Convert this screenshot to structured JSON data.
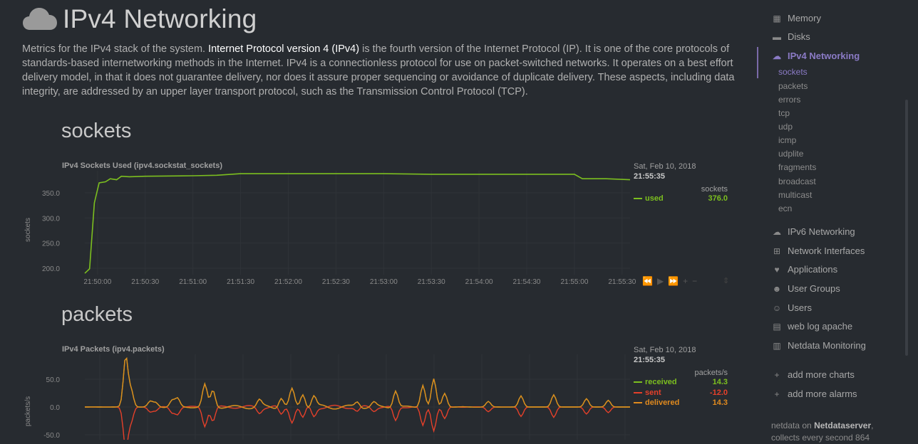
{
  "page": {
    "title": "IPv4 Networking",
    "intro_before": "Metrics for the IPv4 stack of the system. ",
    "intro_link": "Internet Protocol version 4 (IPv4)",
    "intro_after": " is the fourth version of the Internet Protocol (IP). It is one of the core protocols of standards-based internetworking methods in the Internet. IPv4 is a connectionless protocol for use on packet-switched networks. It operates on a best effort delivery model, in that it does not guarantee delivery, nor does it assure proper sequencing or avoidance of duplicate delivery. These aspects, including data integrity, are addressed by an upper layer transport protocol, such as the Transmission Control Protocol (TCP)."
  },
  "sections": {
    "sockets": {
      "heading": "sockets",
      "chart_title": "IPv4 Sockets Used (ipv4.sockstat_sockets)",
      "legend": {
        "date": "Sat, Feb 10, 2018",
        "time": "21:55:35",
        "units": "sockets",
        "rows": [
          {
            "name": "used",
            "value": "376.0",
            "color": "#7cbf1f"
          }
        ]
      }
    },
    "packets": {
      "heading": "packets",
      "chart_title": "IPv4 Packets (ipv4.packets)",
      "legend": {
        "date": "Sat, Feb 10, 2018",
        "time": "21:55:35",
        "units": "packets/s",
        "rows": [
          {
            "name": "received",
            "value": "14.3",
            "color": "#7cbf1f"
          },
          {
            "name": "sent",
            "value": "-12.0",
            "color": "#e5402a"
          },
          {
            "name": "delivered",
            "value": "14.3",
            "color": "#e08a1e"
          }
        ]
      }
    }
  },
  "chart_data": [
    {
      "type": "line",
      "title": "IPv4 Sockets Used (ipv4.sockstat_sockets)",
      "ylabel": "sockets",
      "yticks": [
        "350.0",
        "300.0",
        "250.0",
        "200.0"
      ],
      "xticks": [
        "21:50:00",
        "21:50:30",
        "21:51:00",
        "21:51:30",
        "21:52:00",
        "21:52:30",
        "21:53:00",
        "21:53:30",
        "21:54:00",
        "21:54:30",
        "21:55:00",
        "21:55:30"
      ],
      "series": [
        {
          "name": "used",
          "color": "#7cbf1f",
          "points": [
            [
              "21:49:52",
              190
            ],
            [
              "21:49:55",
              199
            ],
            [
              "21:49:58",
              330
            ],
            [
              "21:50:01",
              370
            ],
            [
              "21:50:05",
              372
            ],
            [
              "21:50:08",
              378
            ],
            [
              "21:50:12",
              376
            ],
            [
              "21:50:15",
              383
            ],
            [
              "21:50:20",
              382
            ],
            [
              "21:50:30",
              383
            ],
            [
              "21:51:00",
              384
            ],
            [
              "21:51:15",
              385
            ],
            [
              "21:51:30",
              388
            ],
            [
              "21:53:00",
              388
            ],
            [
              "21:53:30",
              387
            ],
            [
              "21:54:00",
              387
            ],
            [
              "21:55:00",
              387
            ],
            [
              "21:55:05",
              378
            ],
            [
              "21:55:20",
              378
            ],
            [
              "21:55:35",
              376
            ]
          ]
        }
      ]
    },
    {
      "type": "line",
      "title": "IPv4 Packets (ipv4.packets)",
      "ylabel": "packets/s",
      "yticks": [
        "50.0",
        "0.0",
        "-50.0"
      ],
      "series": [
        {
          "name": "received",
          "color": "#7cbf1f"
        },
        {
          "name": "sent",
          "color": "#e5402a"
        },
        {
          "name": "delivered",
          "color": "#e08a1e"
        }
      ]
    }
  ],
  "controls": {
    "rewind": "⏪",
    "play": "▶",
    "forward": "⏩",
    "zoom_in": "+",
    "zoom_out": "−",
    "resize": "⇕"
  },
  "sidebar": {
    "items_top": [
      {
        "label": "Memory",
        "icon": "memory-icon",
        "glyph": "▦"
      },
      {
        "label": "Disks",
        "icon": "disks-icon",
        "glyph": "▬"
      }
    ],
    "active": {
      "label": "IPv4 Networking",
      "icon": "cloud-icon",
      "glyph": "☁"
    },
    "sub_items": [
      "sockets",
      "packets",
      "errors",
      "tcp",
      "udp",
      "icmp",
      "udplite",
      "fragments",
      "broadcast",
      "multicast",
      "ecn"
    ],
    "items_bottom": [
      {
        "label": "IPv6 Networking",
        "icon": "cloud-icon",
        "glyph": "☁"
      },
      {
        "label": "Network Interfaces",
        "icon": "sitemap-icon",
        "glyph": "⊞"
      },
      {
        "label": "Applications",
        "icon": "heartbeat-icon",
        "glyph": "♥"
      },
      {
        "label": "User Groups",
        "icon": "users-icon",
        "glyph": "☻"
      },
      {
        "label": "Users",
        "icon": "user-icon",
        "glyph": "☺"
      },
      {
        "label": "web log apache",
        "icon": "file-icon",
        "glyph": "▤"
      },
      {
        "label": "Netdata Monitoring",
        "icon": "bar-chart-icon",
        "glyph": "▥"
      }
    ],
    "actions": [
      {
        "label": "add more charts",
        "glyph": "+"
      },
      {
        "label": "add more alarms",
        "glyph": "+"
      }
    ],
    "footer_prefix": "netdata on ",
    "footer_host": "Netdataserver",
    "footer_suffix": ",",
    "footer_line2": "collects every second 864"
  }
}
